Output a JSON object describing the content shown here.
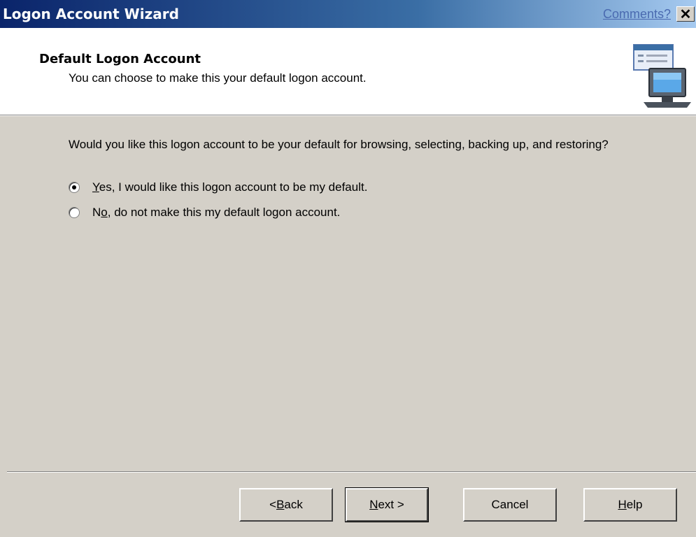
{
  "window": {
    "title": "Logon Account Wizard",
    "comments_link": "Comments?",
    "close_glyph": "✕"
  },
  "header": {
    "heading": "Default Logon Account",
    "subheading": "You can choose to make this your default logon account.",
    "icon": "computer-settings-icon"
  },
  "body": {
    "question": "Would you like this logon account to be your default for browsing, selecting, backing up, and restoring?",
    "options": [
      {
        "prefix": "",
        "accel": "Y",
        "rest": "es, I would like this logon account to be my default.",
        "checked": true
      },
      {
        "prefix": "N",
        "accel": "o",
        "rest": ", do not make this my default logon account.",
        "checked": false
      }
    ]
  },
  "buttons": {
    "back": {
      "prefix": "< ",
      "accel": "B",
      "rest": "ack"
    },
    "next": {
      "prefix": "",
      "accel": "N",
      "rest": "ext >"
    },
    "cancel": "Cancel",
    "help": {
      "prefix": "",
      "accel": "H",
      "rest": "elp"
    }
  },
  "colors": {
    "titlebar_start": "#0a246a",
    "face": "#d4d0c8",
    "header_bg": "#ffffff"
  }
}
